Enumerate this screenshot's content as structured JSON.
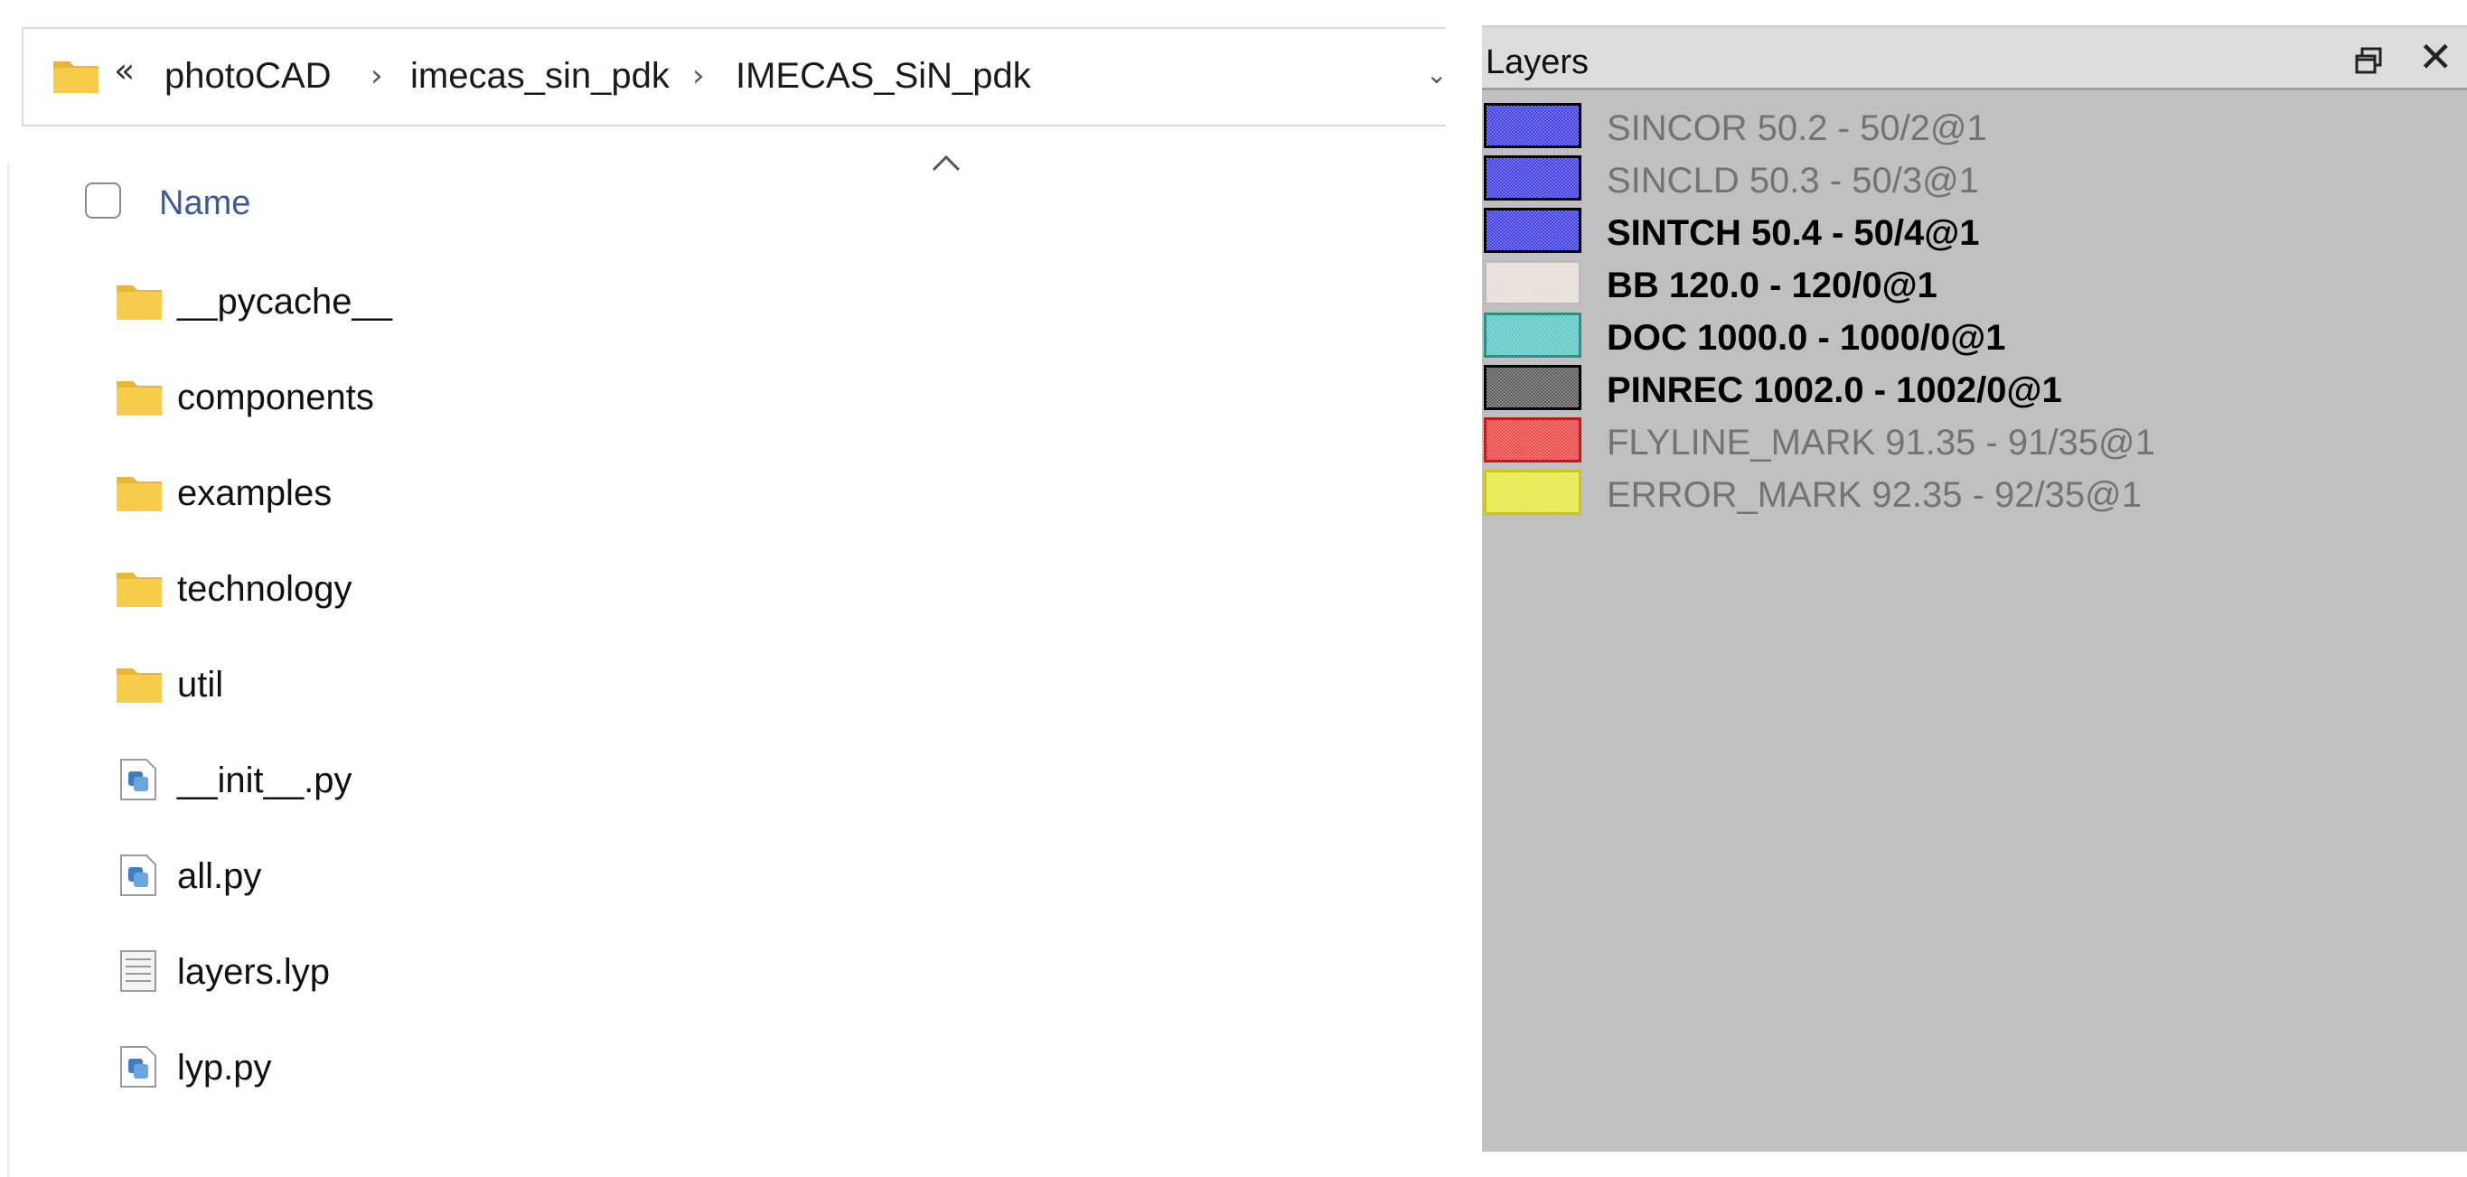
{
  "explorer": {
    "breadcrumb": {
      "overflow": "«",
      "items": [
        "photoCAD",
        "imecas_sin_pdk",
        "IMECAS_SiN_pdk"
      ],
      "separator": "›"
    },
    "column_header": "Name",
    "files": [
      {
        "name": "__pycache__",
        "icon": "folder-icon"
      },
      {
        "name": "components",
        "icon": "folder-icon"
      },
      {
        "name": "examples",
        "icon": "folder-icon"
      },
      {
        "name": "technology",
        "icon": "folder-icon"
      },
      {
        "name": "util",
        "icon": "folder-icon"
      },
      {
        "name": "__init__.py",
        "icon": "python-file-icon"
      },
      {
        "name": "all.py",
        "icon": "python-file-icon"
      },
      {
        "name": "layers.lyp",
        "icon": "text-file-icon"
      },
      {
        "name": "lyp.py",
        "icon": "python-file-icon"
      }
    ]
  },
  "layers_panel": {
    "title": "Layers",
    "close_glyph": "✕",
    "layers": [
      {
        "name": "SINCOR 50.2 - 50/2@1",
        "color": "#2b2be6",
        "visible": false
      },
      {
        "name": "SINCLD 50.3 - 50/3@1",
        "color": "#2b2be6",
        "visible": false
      },
      {
        "name": "SINTCH 50.4 - 50/4@1",
        "color": "#2b2be6",
        "visible": true
      },
      {
        "name": "BB 120.0 - 120/0@1",
        "color": "#e2d8d2",
        "visible": true
      },
      {
        "name": "DOC 1000.0 - 1000/0@1",
        "color": "#4cc3bd",
        "visible": true
      },
      {
        "name": "PINREC 1002.0 - 1002/0@1",
        "color": "#4a4a4a",
        "visible": true
      },
      {
        "name": "FLYLINE_MARK 91.35 - 91/35@1",
        "color": "#ee3333",
        "visible": false
      },
      {
        "name": "ERROR_MARK 92.35 - 92/35@1",
        "color": "#e6e630",
        "visible": false
      }
    ]
  }
}
